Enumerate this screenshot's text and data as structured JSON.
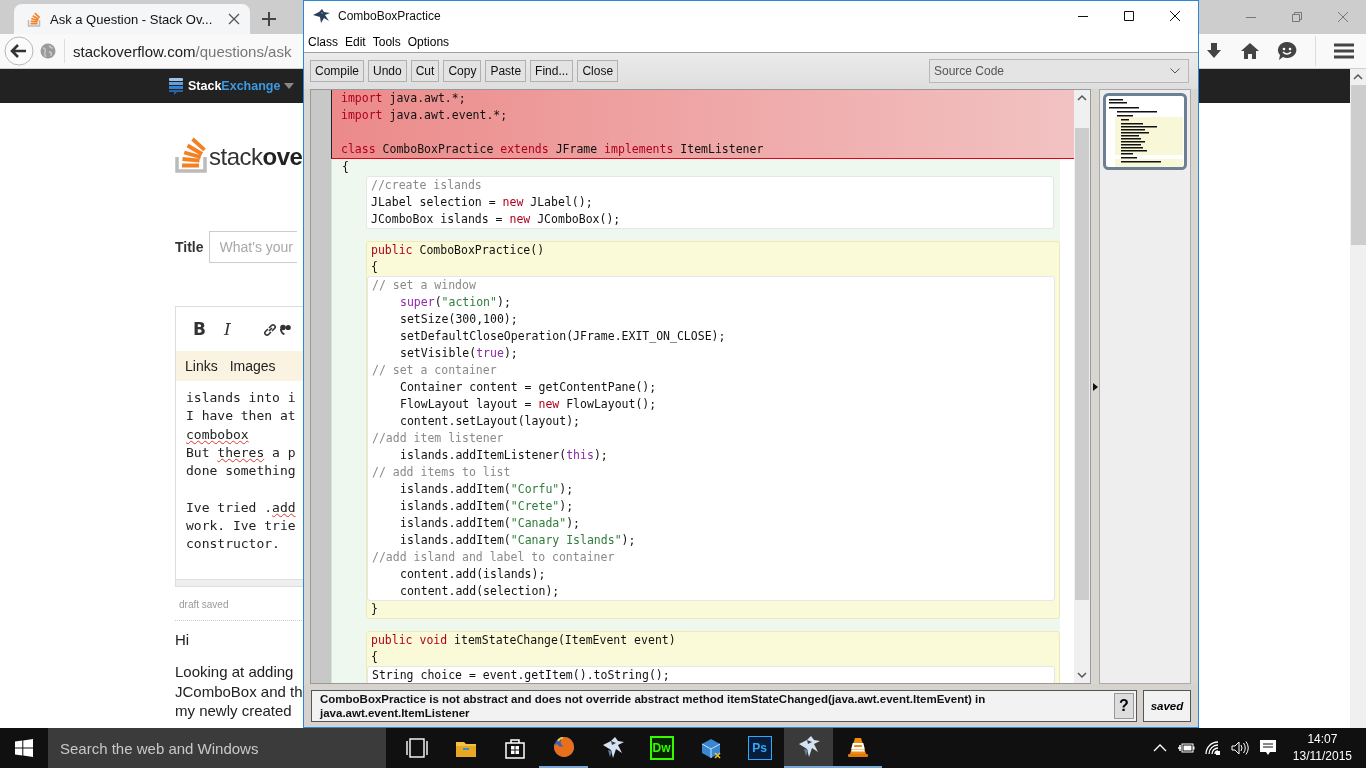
{
  "browser": {
    "tab_title": "Ask a Question - Stack Ov...",
    "url": {
      "host": "stackoverflow.com",
      "path": "/questions/ask"
    },
    "brand": {
      "first": "Stack",
      "second": "Exchange"
    },
    "logo": "stack**ove**",
    "title_label": "Title",
    "title_placeholder": "What's your",
    "format_buttons": [
      "B",
      "I"
    ],
    "editor_tabs": [
      "Links",
      "Images"
    ],
    "text_lines": [
      {
        "segments": [
          {
            "text": "islands into i",
            "misspelled": false
          }
        ]
      },
      {
        "segments": [
          {
            "text": "I have then at",
            "misspelled": false
          }
        ]
      },
      {
        "segments": [
          {
            "text": "combobox",
            "misspelled": true
          }
        ]
      },
      {
        "segments": [
          {
            "text": "But ",
            "misspelled": false
          },
          {
            "text": "theres",
            "misspelled": true
          },
          {
            "text": " a p",
            "misspelled": false
          }
        ]
      },
      {
        "segments": [
          {
            "text": "done something",
            "misspelled": false
          }
        ]
      },
      {
        "space_before": true,
        "segments": [
          {
            "text": "Ive tried .",
            "misspelled": false
          },
          {
            "text": "add",
            "misspelled": true
          }
        ]
      },
      {
        "segments": [
          {
            "text": "work. Ive trie",
            "misspelled": false
          }
        ]
      },
      {
        "segments": [
          {
            "text": "constructor.",
            "misspelled": false
          }
        ]
      }
    ],
    "draft_status": "draft saved",
    "greeting": "Hi",
    "paragraph": "Looking at adding\nJComboBox and th\nmy newly created"
  },
  "editor_window": {
    "title": "ComboBoxPractice",
    "menus": [
      "Class",
      "Edit",
      "Tools",
      "Options"
    ],
    "buttons": [
      "Compile",
      "Undo",
      "Cut",
      "Copy",
      "Paste",
      "Find...",
      "Close"
    ],
    "view_select": "Source Code",
    "code": [
      {
        "kind": "error",
        "lines": [
          {
            "tokens": [
              {
                "kind": "keyword",
                "text": "import"
              },
              {
                "kind": "plain",
                "text": " java.awt.*;"
              }
            ]
          },
          {
            "tokens": [
              {
                "kind": "keyword",
                "text": "import"
              },
              {
                "kind": "plain",
                "text": " java.awt.event.*;"
              }
            ]
          },
          {
            "space_before": true,
            "tokens": [
              {
                "kind": "keyword",
                "text": "class"
              },
              {
                "kind": "plain",
                "text": " ComboBoxPractice "
              },
              {
                "kind": "keyword",
                "text": "extends"
              },
              {
                "kind": "plain",
                "text": " JFrame "
              },
              {
                "kind": "keyword",
                "text": "implements"
              },
              {
                "kind": "plain",
                "text": " ItemListener"
              }
            ]
          }
        ]
      },
      {
        "kind": "class",
        "lines": [
          {
            "tokens": [
              {
                "kind": "plain",
                "text": "{"
              }
            ]
          }
        ],
        "children": [
          {
            "kind": "body",
            "lines": [
              {
                "tokens": [
                  {
                    "kind": "comment",
                    "text": "//create islands"
                  }
                ]
              },
              {
                "tokens": [
                  {
                    "kind": "plain",
                    "text": "JLabel selection = "
                  },
                  {
                    "kind": "keyword",
                    "text": "new"
                  },
                  {
                    "kind": "plain",
                    "text": " JLabel();"
                  }
                ]
              },
              {
                "tokens": [
                  {
                    "kind": "plain",
                    "text": "JComboBox islands = "
                  },
                  {
                    "kind": "keyword",
                    "text": "new"
                  },
                  {
                    "kind": "plain",
                    "text": " JComboBox();"
                  }
                ]
              }
            ]
          },
          {
            "kind": "method",
            "lines": [
              {
                "tokens": [
                  {
                    "kind": "keyword",
                    "text": "public"
                  },
                  {
                    "kind": "plain",
                    "text": " ComboBoxPractice()"
                  }
                ]
              },
              {
                "tokens": [
                  {
                    "kind": "plain",
                    "text": "{"
                  }
                ]
              }
            ],
            "children": [
              {
                "kind": "body",
                "lines": [
                  {
                    "tokens": [
                      {
                        "kind": "comment",
                        "text": "// set a window"
                      }
                    ]
                  },
                  {
                    "indent": true,
                    "tokens": [
                      {
                        "kind": "literal",
                        "text": "super"
                      },
                      {
                        "kind": "plain",
                        "text": "("
                      },
                      {
                        "kind": "string",
                        "text": "\"action\""
                      },
                      {
                        "kind": "plain",
                        "text": ");"
                      }
                    ]
                  },
                  {
                    "indent": true,
                    "tokens": [
                      {
                        "kind": "plain",
                        "text": "setSize(300,100);"
                      }
                    ]
                  },
                  {
                    "indent": true,
                    "tokens": [
                      {
                        "kind": "plain",
                        "text": "setDefaultCloseOperation(JFrame.EXIT_ON_CLOSE);"
                      }
                    ]
                  },
                  {
                    "indent": true,
                    "tokens": [
                      {
                        "kind": "plain",
                        "text": "setVisible("
                      },
                      {
                        "kind": "literal",
                        "text": "true"
                      },
                      {
                        "kind": "plain",
                        "text": ");"
                      }
                    ]
                  },
                  {
                    "tokens": [
                      {
                        "kind": "comment",
                        "text": "// set a container"
                      }
                    ]
                  },
                  {
                    "indent": true,
                    "tokens": [
                      {
                        "kind": "plain",
                        "text": "Container content = getContentPane();"
                      }
                    ]
                  },
                  {
                    "indent": true,
                    "tokens": [
                      {
                        "kind": "plain",
                        "text": "FlowLayout layout = "
                      },
                      {
                        "kind": "keyword",
                        "text": "new"
                      },
                      {
                        "kind": "plain",
                        "text": " FlowLayout();"
                      }
                    ]
                  },
                  {
                    "indent": true,
                    "tokens": [
                      {
                        "kind": "plain",
                        "text": "content.setLayout(layout);"
                      }
                    ]
                  },
                  {
                    "tokens": [
                      {
                        "kind": "comment",
                        "text": "//add item listener"
                      }
                    ]
                  },
                  {
                    "indent": true,
                    "tokens": [
                      {
                        "kind": "plain",
                        "text": "islands.addItemListener("
                      },
                      {
                        "kind": "literal",
                        "text": "this"
                      },
                      {
                        "kind": "plain",
                        "text": ");"
                      }
                    ]
                  },
                  {
                    "tokens": [
                      {
                        "kind": "comment",
                        "text": "// add items to list"
                      }
                    ]
                  },
                  {
                    "indent": true,
                    "tokens": [
                      {
                        "kind": "plain",
                        "text": "islands.addItem("
                      },
                      {
                        "kind": "string",
                        "text": "\"Corfu\""
                      },
                      {
                        "kind": "plain",
                        "text": ");"
                      }
                    ]
                  },
                  {
                    "indent": true,
                    "tokens": [
                      {
                        "kind": "plain",
                        "text": "islands.addItem("
                      },
                      {
                        "kind": "string",
                        "text": "\"Crete\""
                      },
                      {
                        "kind": "plain",
                        "text": ");"
                      }
                    ]
                  },
                  {
                    "indent": true,
                    "tokens": [
                      {
                        "kind": "plain",
                        "text": "islands.addItem("
                      },
                      {
                        "kind": "string",
                        "text": "\"Canada\""
                      },
                      {
                        "kind": "plain",
                        "text": ");"
                      }
                    ]
                  },
                  {
                    "indent": true,
                    "tokens": [
                      {
                        "kind": "plain",
                        "text": "islands.addItem("
                      },
                      {
                        "kind": "string",
                        "text": "\"Canary Islands\""
                      },
                      {
                        "kind": "plain",
                        "text": ");"
                      }
                    ]
                  },
                  {
                    "tokens": [
                      {
                        "kind": "comment",
                        "text": "//add island and label to container"
                      }
                    ]
                  },
                  {
                    "indent": true,
                    "tokens": [
                      {
                        "kind": "plain",
                        "text": "content.add(islands);"
                      }
                    ]
                  },
                  {
                    "indent": true,
                    "tokens": [
                      {
                        "kind": "plain",
                        "text": "content.add(selection);"
                      }
                    ]
                  }
                ]
              }
            ],
            "tail": [
              {
                "tokens": [
                  {
                    "kind": "plain",
                    "text": "}"
                  }
                ]
              }
            ]
          },
          {
            "kind": "method",
            "lines": [
              {
                "tokens": [
                  {
                    "kind": "keyword",
                    "text": "public void"
                  },
                  {
                    "kind": "plain",
                    "text": " itemStateChange(ItemEvent event)"
                  }
                ]
              },
              {
                "tokens": [
                  {
                    "kind": "plain",
                    "text": "{"
                  }
                ]
              }
            ],
            "children": [
              {
                "kind": "body",
                "lines": [
                  {
                    "tokens": [
                      {
                        "kind": "plain",
                        "text": "String choice = event.getItem().toString();"
                      }
                    ]
                  }
                ]
              }
            ]
          }
        ]
      }
    ],
    "message": "ComboBoxPractice is not abstract and does not override abstract method itemStateChanged(java.awt.event.ItemEvent) in java.awt.event.ItemListener",
    "help_button": "?",
    "save_status": "saved"
  },
  "taskbar": {
    "search_placeholder": "Search the web and Windows",
    "apps": [
      {
        "kind": "taskview",
        "running": false,
        "selected": false
      },
      {
        "kind": "explorer",
        "running": false,
        "selected": false
      },
      {
        "kind": "store",
        "running": false,
        "selected": false
      },
      {
        "kind": "firefox",
        "running": true,
        "selected": false
      },
      {
        "kind": "bluej",
        "running": false,
        "selected": false
      },
      {
        "kind": "dreamweaver",
        "label": "Dw",
        "running": false,
        "selected": false
      },
      {
        "kind": "toolbox",
        "running": false,
        "selected": false
      },
      {
        "kind": "photoshop",
        "label": "Ps",
        "running": false,
        "selected": false
      },
      {
        "kind": "bluej",
        "running": true,
        "selected": true
      },
      {
        "kind": "vlc",
        "running": true,
        "selected": false
      }
    ],
    "time": "14:07",
    "date": "13/11/2015"
  }
}
